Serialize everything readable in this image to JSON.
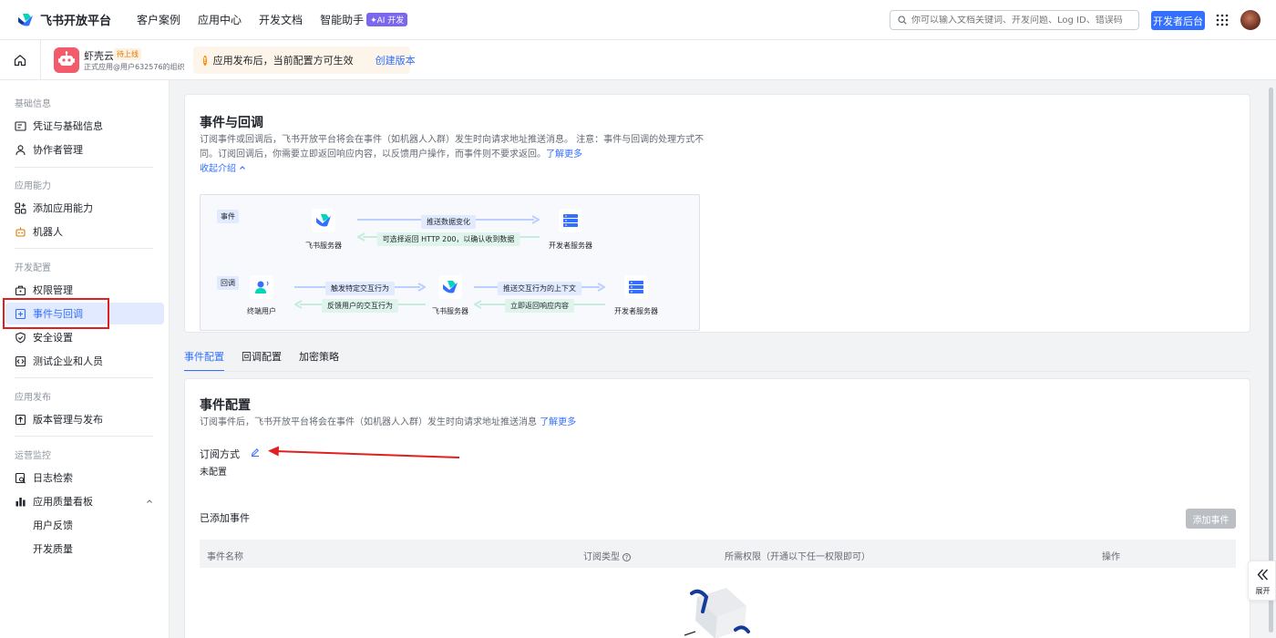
{
  "topnav": {
    "brand": "飞书开放平台",
    "links": [
      "客户案例",
      "应用中心",
      "开发文档",
      "智能助手"
    ],
    "ai_badge": "✦AI 开发",
    "search_placeholder": "你可以输入文档关键词、开发问题、Log ID、错误码",
    "console_button": "开发者后台"
  },
  "appbar": {
    "app_name": "虾壳云",
    "app_status": "待上线",
    "app_org": "正式应用@用户632576的组织",
    "notice_text": "应用发布后，当前配置方可生效",
    "notice_link": "创建版本"
  },
  "sidebar": {
    "sections": [
      {
        "title": "基础信息",
        "items": [
          "凭证与基础信息",
          "协作者管理"
        ]
      },
      {
        "title": "应用能力",
        "items": [
          "添加应用能力",
          "机器人"
        ]
      },
      {
        "title": "开发配置",
        "items": [
          "权限管理",
          "事件与回调",
          "安全设置",
          "测试企业和人员"
        ]
      },
      {
        "title": "应用发布",
        "items": [
          "版本管理与发布"
        ]
      },
      {
        "title": "运营监控",
        "items": [
          "日志检索",
          "应用质量看板",
          "用户反馈",
          "开发质量"
        ]
      }
    ]
  },
  "intro": {
    "title": "事件与回调",
    "desc_line1": "订阅事件或回调后，飞书开放平台将会在事件（如机器人入群）发生时向请求地址推送消息。 注意：事件与回调的处理方式不",
    "desc_line2": "同。订阅回调后，你需要立即返回响应内容，以反馈用户操作，而事件则不要求返回。",
    "learn_more": "了解更多",
    "collapse": "收起介绍"
  },
  "diagram": {
    "event_tag": "事件",
    "callback_tag": "回调",
    "feishu_server": "飞书服务器",
    "dev_server": "开发者服务器",
    "end_user": "终端用户",
    "push_data": "推送数据变化",
    "return_200": "可选择返回 HTTP 200，以确认收到数据",
    "trigger": "触发特定交互行为",
    "feedback": "反馈用户的交互行为",
    "push_context": "推送交互行为的上下文",
    "return_now": "立即返回响应内容"
  },
  "tabs": [
    "事件配置",
    "回调配置",
    "加密策略"
  ],
  "event_config": {
    "title": "事件配置",
    "desc": "订阅事件后，飞书开放平台将会在事件（如机器人入群）发生时向请求地址推送消息",
    "learn_more": "了解更多",
    "subscribe_label": "订阅方式",
    "subscribe_value": "未配置",
    "added_events": "已添加事件",
    "add_button": "添加事件",
    "columns": [
      "事件名称",
      "订阅类型",
      "所需权限（开通以下任一权限即可）",
      "操作"
    ]
  },
  "expand_label": "展开"
}
